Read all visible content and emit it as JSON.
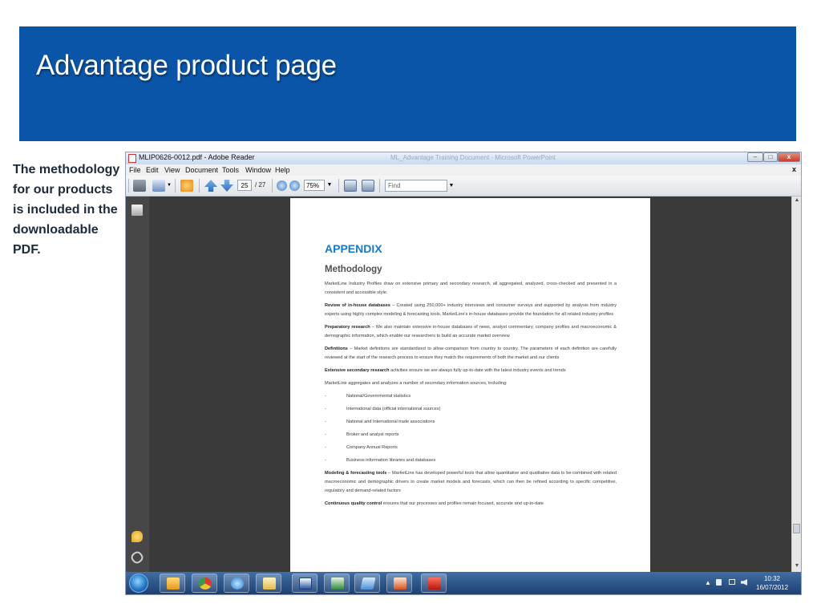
{
  "slide": {
    "title": "Advantage product page",
    "side_text": "The methodology for our products is included in the downloadable PDF."
  },
  "window": {
    "title": "MLIP0626-0012.pdf - Adobe Reader",
    "faded_title": "ML_Advantage Training Document - Microsoft PowerPoint",
    "buttons": {
      "minimize": "–",
      "maximize": "□",
      "close": "x"
    }
  },
  "menu": {
    "items": [
      "File",
      "Edit",
      "View",
      "Document",
      "Tools",
      "Window",
      "Help"
    ],
    "doc_close": "x"
  },
  "toolbar": {
    "page_current": "25",
    "page_total": "/ 27",
    "zoom": "75%",
    "find_placeholder": "Find",
    "dropdown_arrow": "▼"
  },
  "icons": {
    "print": "printer-icon",
    "email": "email-icon",
    "collab": "collaborate-icon",
    "prev": "arrow-up-icon",
    "next": "arrow-down-icon",
    "zoom_out": "zoom-out-icon",
    "zoom_in": "zoom-in-icon",
    "fit_page": "fit-page-icon",
    "full_screen": "full-screen-icon"
  },
  "pdf": {
    "heading": "APPENDIX",
    "subheading": "Methodology",
    "intro": "MarketLine Industry Profiles draw on extensive primary and secondary research, all aggregated, analyzed, cross-checked and presented in a consistent and accessible style.",
    "p1_label": "Review of in-house databases",
    "p1_text": " – Created using 250,000+ industry interviews and consumer surveys and supported by analysis from industry experts using highly complex modeling & forecasting tools, MarketLine's in-house databases provide the foundation for all related industry profiles",
    "p2_label": "Preparatory research",
    "p2_text": " – We also maintain extensive in-house databases of news, analyst commentary, company profiles and macroeconomic & demographic information, which enable our researchers to build an accurate market overview",
    "p3_label": "Definitions",
    "p3_text": " – Market definitions are standardized to allow comparison from country to country. The parameters of each definition are carefully reviewed at the start of the research process to ensure they match the requirements of both the market and our clients",
    "p4_label": "Extensive secondary research",
    "p4_text": " activities ensure we are always fully up-to-date with the latest industry events and trends",
    "p5_text": "MarketLine aggregates and analyzes a number of secondary information sources, including:",
    "list": [
      "National/Governmental statistics",
      "International data (official international sources)",
      "National and International trade associations",
      "Broker and analyst reports",
      "Company Annual Reports",
      "Business information libraries and databases"
    ],
    "p6_label": "Modeling & forecasting tools",
    "p6_text": " – MarketLine has developed powerful tools that allow quantitative and qualitative data to be combined with related macroeconomic and demographic drivers to create market models and forecasts, which can then be refined according to specific competitive, regulatory and demand-related factors",
    "p7_label": "Continuous quality control",
    "p7_text": " ensures that our processes and profiles remain focused, accurate and up-to-date"
  },
  "taskbar": {
    "apps": [
      "outlook-icon",
      "chrome-icon",
      "ie-icon",
      "explorer-icon",
      "word-icon",
      "excel-icon",
      "pdf-reader-icon",
      "powerpoint-icon",
      "adobe-reader-icon"
    ],
    "time": "10:32",
    "date": "16/07/2012",
    "tray_up": "▲"
  },
  "colors": {
    "slide_blue": "#0a55a8",
    "pdf_heading": "#1a78c2"
  }
}
